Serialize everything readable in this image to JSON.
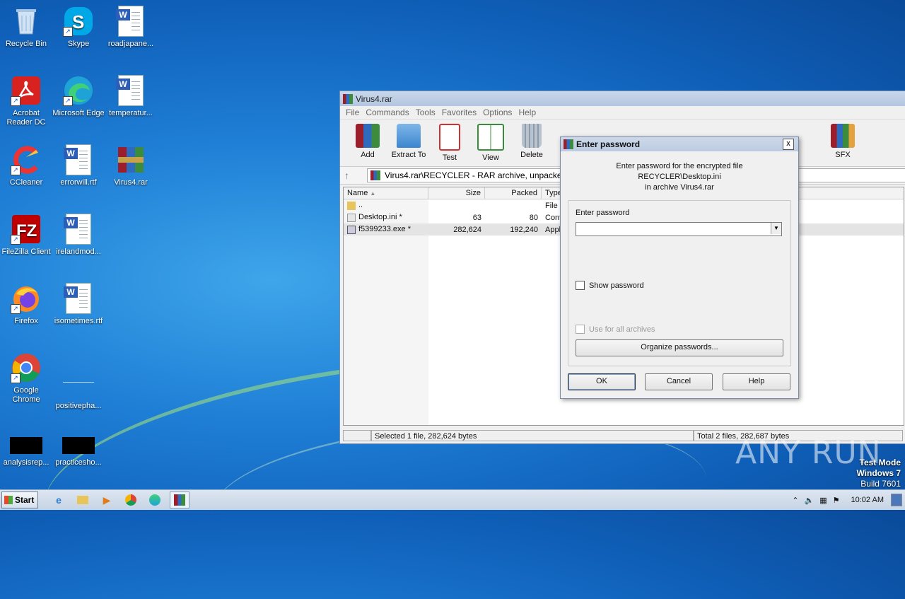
{
  "desktop": {
    "icons": [
      {
        "label": "Recycle Bin"
      },
      {
        "label": "Skype"
      },
      {
        "label": "roadjapane..."
      },
      {
        "label": "Acrobat Reader DC"
      },
      {
        "label": "Microsoft Edge"
      },
      {
        "label": "temperatur..."
      },
      {
        "label": "CCleaner"
      },
      {
        "label": "errorwill.rtf"
      },
      {
        "label": "Virus4.rar"
      },
      {
        "label": "FileZilla Client"
      },
      {
        "label": "irelandmod..."
      },
      {
        "label": "Firefox"
      },
      {
        "label": "isometimes.rtf"
      },
      {
        "label": "Google Chrome"
      },
      {
        "label": "positivepha..."
      },
      {
        "label": "analysisrep..."
      },
      {
        "label": "practicesho..."
      }
    ]
  },
  "winrar": {
    "title": "Virus4.rar",
    "menu": [
      "File",
      "Commands",
      "Tools",
      "Favorites",
      "Options",
      "Help"
    ],
    "toolbar": [
      {
        "label": "Add",
        "icon": "add-archive-icon"
      },
      {
        "label": "Extract To",
        "icon": "extract-folder-icon"
      },
      {
        "label": "Test",
        "icon": "test-clipboard-icon"
      },
      {
        "label": "View",
        "icon": "view-book-icon"
      },
      {
        "label": "Delete",
        "icon": "trash-icon"
      },
      {
        "label": "SFX",
        "icon": "sfx-icon"
      }
    ],
    "address": "Virus4.rar\\RECYCLER - RAR archive, unpacked s",
    "columns": {
      "name": "Name",
      "size": "Size",
      "packed": "Packed",
      "type": "Type"
    },
    "files": [
      {
        "name": "..",
        "size": "",
        "packed": "",
        "type": "File"
      },
      {
        "name": "Desktop.ini *",
        "size": "63",
        "packed": "80",
        "type": "Conf"
      },
      {
        "name": "f5399233.exe *",
        "size": "282,624",
        "packed": "192,240",
        "type": "Appl"
      }
    ],
    "status_left": "Selected 1 file, 282,624 bytes",
    "status_right": "Total 2 files, 282,687 bytes"
  },
  "dialog": {
    "title": "Enter password",
    "close": "x",
    "message_line1": "Enter password for the encrypted file",
    "message_line2": "RECYCLER\\Desktop.ini",
    "message_line3": "in archive Virus4.rar",
    "password_label": "Enter password",
    "password_value": "",
    "show_password": "Show password",
    "use_for_all": "Use for all archives",
    "organize": "Organize passwords...",
    "ok": "OK",
    "cancel": "Cancel",
    "help": "Help"
  },
  "overlay": {
    "watermark": "ANY RUN",
    "testmode_line1": "Test Mode",
    "testmode_line2": "Windows 7",
    "testmode_line3": "Build 7601"
  },
  "taskbar": {
    "start": "Start",
    "clock": "10:02 AM"
  }
}
